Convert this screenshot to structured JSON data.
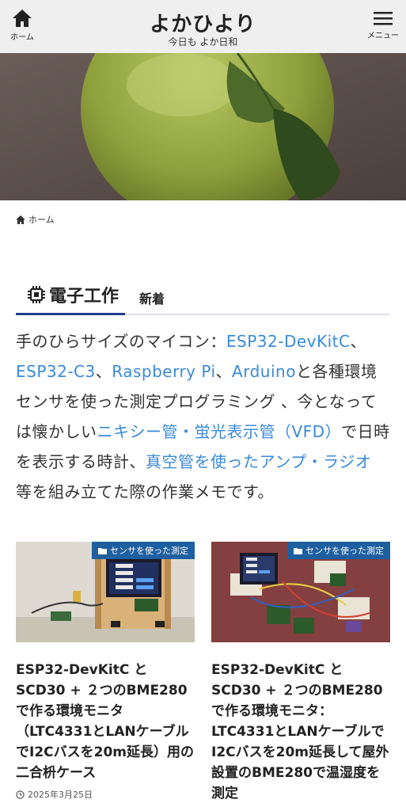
{
  "header": {
    "home_label": "ホーム",
    "title": "よかひより",
    "tagline": "今日も よか日和",
    "menu_label": "メニュー"
  },
  "breadcrumb": {
    "home": "ホーム"
  },
  "category": {
    "title": "電子工作",
    "badge": "新着"
  },
  "description": {
    "t1": "手のひらサイズのマイコン：",
    "l1": "ESP32-DevKitC",
    "t2": "、",
    "l2": "ESP32-C3",
    "t3": "、",
    "l3": "Raspberry Pi",
    "t4": "、",
    "l4": "Arduino",
    "t5": "と各種環境センサを使った測定プログラミング 、今となっては懐かしい",
    "l5": "ニキシー管・蛍光表示管（VFD）",
    "t6": "で日時を表示する時計、",
    "l6": "真空管を使ったアンプ・ラジオ",
    "t7": " 等を組み立てた際の作業メモです。"
  },
  "cards": [
    {
      "tag": "センサを使った測定",
      "title": "ESP32-DevKitC と SCD30 + ２つのBME280で作る環境モニタ（LTC4331とLANケーブルでI2Cバスを20m延長）用の二合枡ケース",
      "date": "2025年3月25日"
    },
    {
      "tag": "センサを使った測定",
      "title": "ESP32-DevKitC と SCD30 + ２つのBME280で作る環境モニタ：LTC4331とLANケーブルでI2Cバスを20m延長して屋外設置のBME280で温湿度を測定"
    }
  ],
  "colors": {
    "link": "#3a8ad8",
    "accent": "#233c8c",
    "tag_bg": "#1e5fa0",
    "header_bg": "#efefef"
  }
}
